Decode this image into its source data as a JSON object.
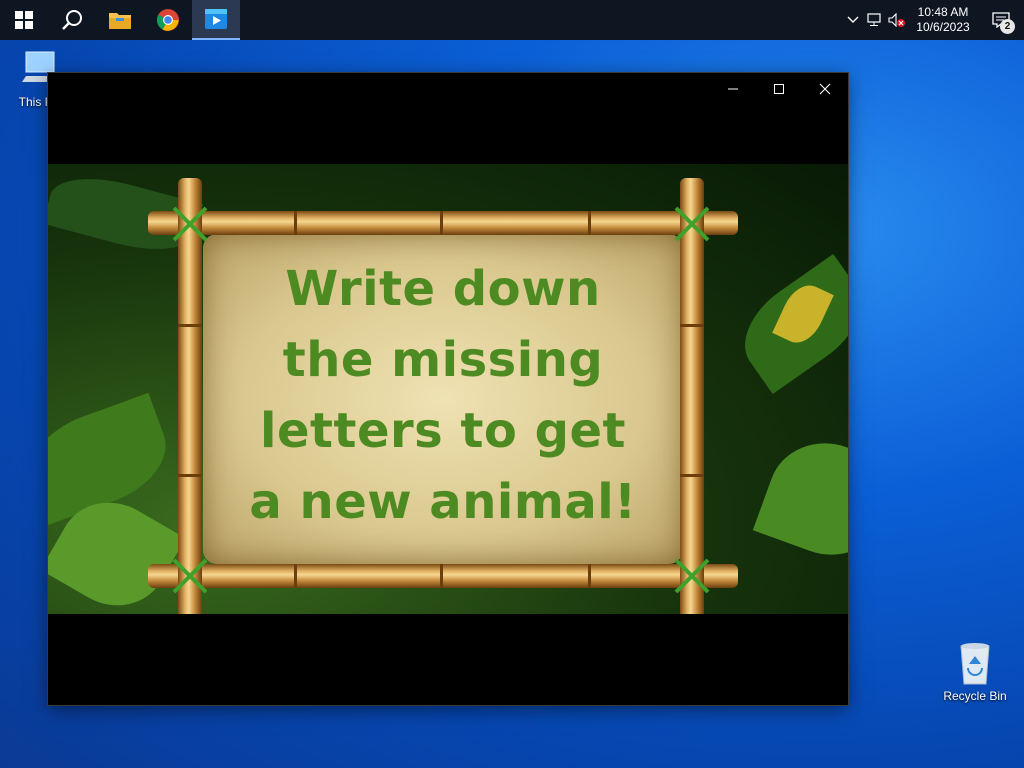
{
  "taskbar": {
    "start": "start-icon",
    "search": "search-icon",
    "explorer": "file-explorer-icon",
    "chrome": "chrome-icon",
    "active_app": "media-app-icon",
    "tray": {
      "chevron": "chevron-up-icon",
      "network": "network-icon",
      "volume": "volume-muted-icon",
      "time": "10:48 AM",
      "date": "10/6/2023",
      "notifications_count": "2"
    }
  },
  "desktop": {
    "this_pc_label": "This PC",
    "recycle_bin_label": "Recycle Bin"
  },
  "window": {
    "minimize": "minimize-icon",
    "maximize": "maximize-icon",
    "close": "close-icon",
    "message_lines": [
      "Write down",
      "the missing",
      "letters to get",
      "a new animal!"
    ]
  },
  "colors": {
    "taskbar_bg": "#0e1622",
    "text_green": "#4e8a22",
    "parchment": "#e3d09a"
  }
}
